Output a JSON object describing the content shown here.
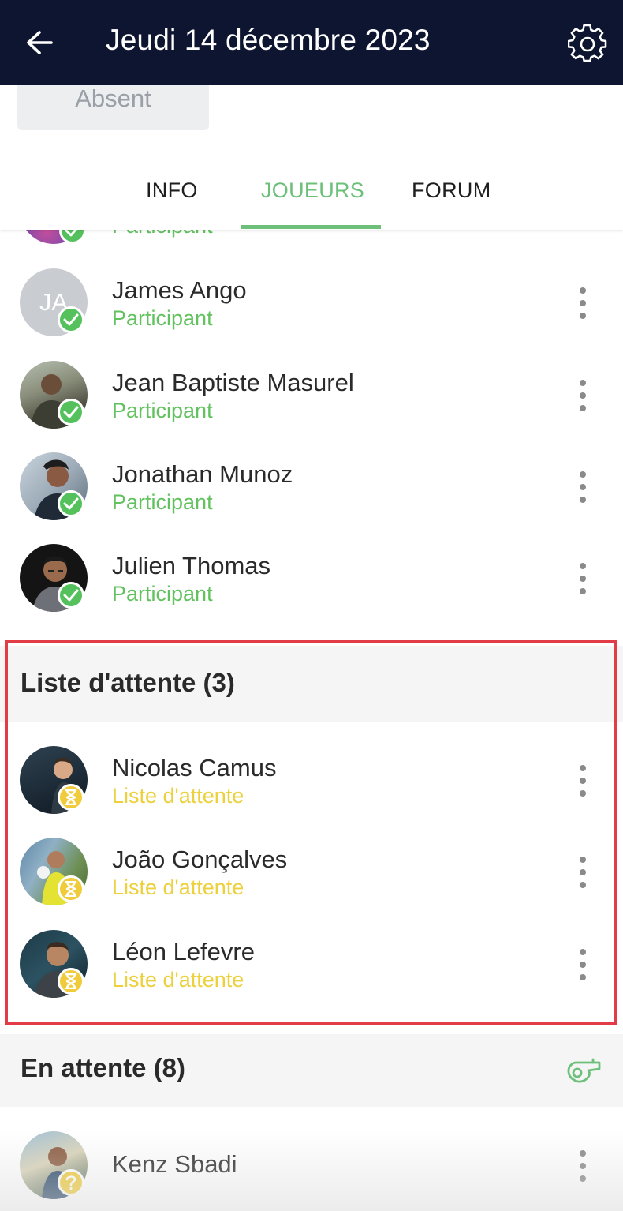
{
  "header": {
    "title": "Jeudi 14 décembre 2023",
    "back_icon": "arrow-left-icon",
    "settings_icon": "gear-icon"
  },
  "absent_button": {
    "label": "Absent"
  },
  "tabs": [
    {
      "label": "INFO",
      "active": false
    },
    {
      "label": "JOUEURS",
      "active": true
    },
    {
      "label": "FORUM",
      "active": false
    }
  ],
  "partial_row": {
    "status": "Participant"
  },
  "participants": [
    {
      "name": "James Ango",
      "status": "Participant",
      "initials": "JA"
    },
    {
      "name": "Jean Baptiste Masurel",
      "status": "Participant"
    },
    {
      "name": "Jonathan Munoz",
      "status": "Participant"
    },
    {
      "name": "Julien Thomas",
      "status": "Participant"
    }
  ],
  "waitlist": {
    "title": "Liste d'attente (3)",
    "players": [
      {
        "name": "Nicolas Camus",
        "status": "Liste d'attente"
      },
      {
        "name": "João Gonçalves",
        "status": "Liste d'attente"
      },
      {
        "name": "Léon Lefevre",
        "status": "Liste d'attente"
      }
    ]
  },
  "pending": {
    "title": "En attente (8)",
    "action_icon": "whistle-icon",
    "players": [
      {
        "name": "Kenz Sbadi"
      }
    ]
  },
  "colors": {
    "header_bg": "#0e1530",
    "accent_green": "#6cc07a",
    "status_green": "#62c25e",
    "status_yellow": "#ecd03c",
    "highlight_red": "#e23c46"
  }
}
